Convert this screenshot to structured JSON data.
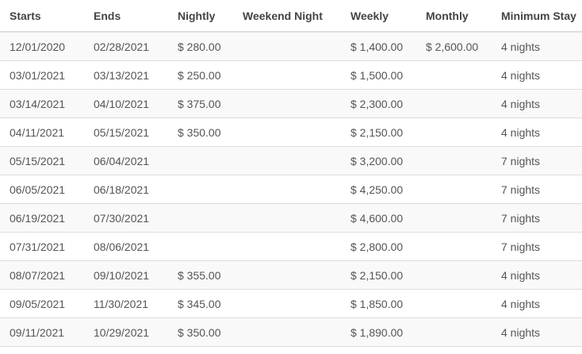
{
  "table": {
    "headers": {
      "starts": "Starts",
      "ends": "Ends",
      "nightly": "Nightly",
      "weekend_night": "Weekend Night",
      "weekly": "Weekly",
      "monthly": "Monthly",
      "minimum_stay": "Minimum Stay"
    },
    "rows": [
      {
        "starts": "12/01/2020",
        "ends": "02/28/2021",
        "nightly": "$ 280.00",
        "weekend_night": "",
        "weekly": "$ 1,400.00",
        "monthly": "$ 2,600.00",
        "minimum_stay": "4 nights"
      },
      {
        "starts": "03/01/2021",
        "ends": "03/13/2021",
        "nightly": "$ 250.00",
        "weekend_night": "",
        "weekly": "$ 1,500.00",
        "monthly": "",
        "minimum_stay": "4 nights"
      },
      {
        "starts": "03/14/2021",
        "ends": "04/10/2021",
        "nightly": "$ 375.00",
        "weekend_night": "",
        "weekly": "$ 2,300.00",
        "monthly": "",
        "minimum_stay": "4 nights"
      },
      {
        "starts": "04/11/2021",
        "ends": "05/15/2021",
        "nightly": "$ 350.00",
        "weekend_night": "",
        "weekly": "$ 2,150.00",
        "monthly": "",
        "minimum_stay": "4 nights"
      },
      {
        "starts": "05/15/2021",
        "ends": "06/04/2021",
        "nightly": "",
        "weekend_night": "",
        "weekly": "$ 3,200.00",
        "monthly": "",
        "minimum_stay": "7 nights"
      },
      {
        "starts": "06/05/2021",
        "ends": "06/18/2021",
        "nightly": "",
        "weekend_night": "",
        "weekly": "$ 4,250.00",
        "monthly": "",
        "minimum_stay": "7 nights"
      },
      {
        "starts": "06/19/2021",
        "ends": "07/30/2021",
        "nightly": "",
        "weekend_night": "",
        "weekly": "$ 4,600.00",
        "monthly": "",
        "minimum_stay": "7 nights"
      },
      {
        "starts": "07/31/2021",
        "ends": "08/06/2021",
        "nightly": "",
        "weekend_night": "",
        "weekly": "$ 2,800.00",
        "monthly": "",
        "minimum_stay": "7 nights"
      },
      {
        "starts": "08/07/2021",
        "ends": "09/10/2021",
        "nightly": "$ 355.00",
        "weekend_night": "",
        "weekly": "$ 2,150.00",
        "monthly": "",
        "minimum_stay": "4 nights"
      },
      {
        "starts": "09/05/2021",
        "ends": "11/30/2021",
        "nightly": "$ 345.00",
        "weekend_night": "",
        "weekly": "$ 1,850.00",
        "monthly": "",
        "minimum_stay": "4 nights"
      },
      {
        "starts": "09/11/2021",
        "ends": "10/29/2021",
        "nightly": "$ 350.00",
        "weekend_night": "",
        "weekly": "$ 1,890.00",
        "monthly": "",
        "minimum_stay": "4 nights"
      }
    ]
  }
}
